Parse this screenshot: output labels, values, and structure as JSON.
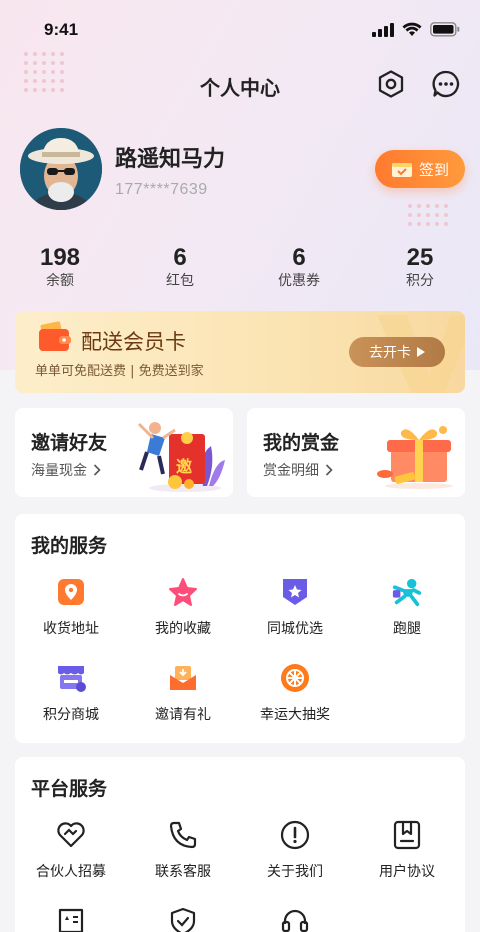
{
  "status_bar": {
    "time": "9:41"
  },
  "header": {
    "title": "个人中心"
  },
  "profile": {
    "name": "路遥知马力",
    "phone": "177****7639",
    "checkin_label": "签到"
  },
  "stats": [
    {
      "value": "198",
      "label": "余额"
    },
    {
      "value": "6",
      "label": "红包"
    },
    {
      "value": "6",
      "label": "优惠券"
    },
    {
      "value": "25",
      "label": "积分"
    }
  ],
  "member_card": {
    "title": "配送会员卡",
    "subtitle": "单单可免配送费 | 免费送到家",
    "button_label": "去开卡",
    "watermark": "V"
  },
  "promo_cards": [
    {
      "title": "邀请好友",
      "subtitle": "海量现金",
      "badge": "邀"
    },
    {
      "title": "我的赏金",
      "subtitle": "赏金明细"
    }
  ],
  "my_services": {
    "title": "我的服务",
    "items": [
      {
        "label": "收货地址",
        "icon": "location-pin-icon"
      },
      {
        "label": "我的收藏",
        "icon": "star-icon"
      },
      {
        "label": "同城优选",
        "icon": "badge-star-icon"
      },
      {
        "label": "跑腿",
        "icon": "runner-icon"
      },
      {
        "label": "积分商城",
        "icon": "shop-icon"
      },
      {
        "label": "邀请有礼",
        "icon": "gift-mail-icon"
      },
      {
        "label": "幸运大抽奖",
        "icon": "lottery-wheel-icon"
      }
    ]
  },
  "platform_services": {
    "title": "平台服务",
    "items": [
      {
        "label": "合伙人招募",
        "icon": "handshake-heart-icon"
      },
      {
        "label": "联系客服",
        "icon": "phone-icon"
      },
      {
        "label": "关于我们",
        "icon": "info-exclamation-icon"
      },
      {
        "label": "用户协议",
        "icon": "bookmark-doc-icon"
      },
      {
        "label": "",
        "icon": "star-doc-icon"
      },
      {
        "label": "",
        "icon": "shield-check-icon"
      },
      {
        "label": "",
        "icon": "headset-icon"
      }
    ]
  },
  "colors": {
    "accent_orange": "#ff7a2e",
    "member_brown": "#6b3a12",
    "hero_pink": "#f8e6ee"
  }
}
